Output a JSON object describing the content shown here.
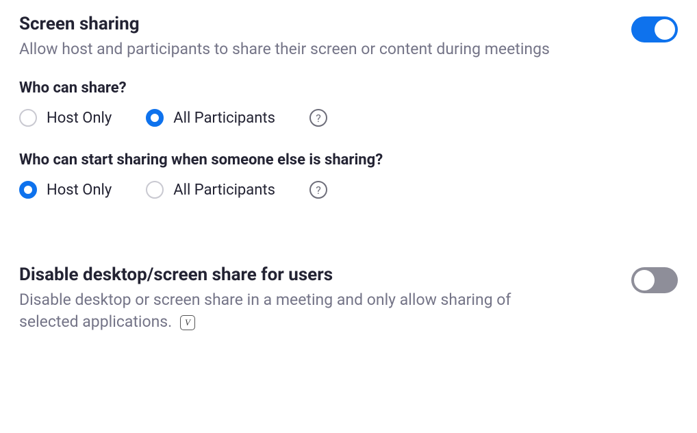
{
  "screenSharing": {
    "title": "Screen sharing",
    "description": "Allow host and participants to share their screen or content during meetings",
    "enabled": true,
    "whoCanShare": {
      "question": "Who can share?",
      "options": {
        "hostOnly": "Host Only",
        "allParticipants": "All Participants"
      },
      "selected": "allParticipants"
    },
    "whoCanStart": {
      "question": "Who can start sharing when someone else is sharing?",
      "options": {
        "hostOnly": "Host Only",
        "allParticipants": "All Participants"
      },
      "selected": "hostOnly"
    }
  },
  "disableDesktop": {
    "title": "Disable desktop/screen share for users",
    "description": "Disable desktop or screen share in a meeting and only allow sharing of selected applications.",
    "enabled": false
  },
  "helpGlyph": "?",
  "varyIconText": "V"
}
